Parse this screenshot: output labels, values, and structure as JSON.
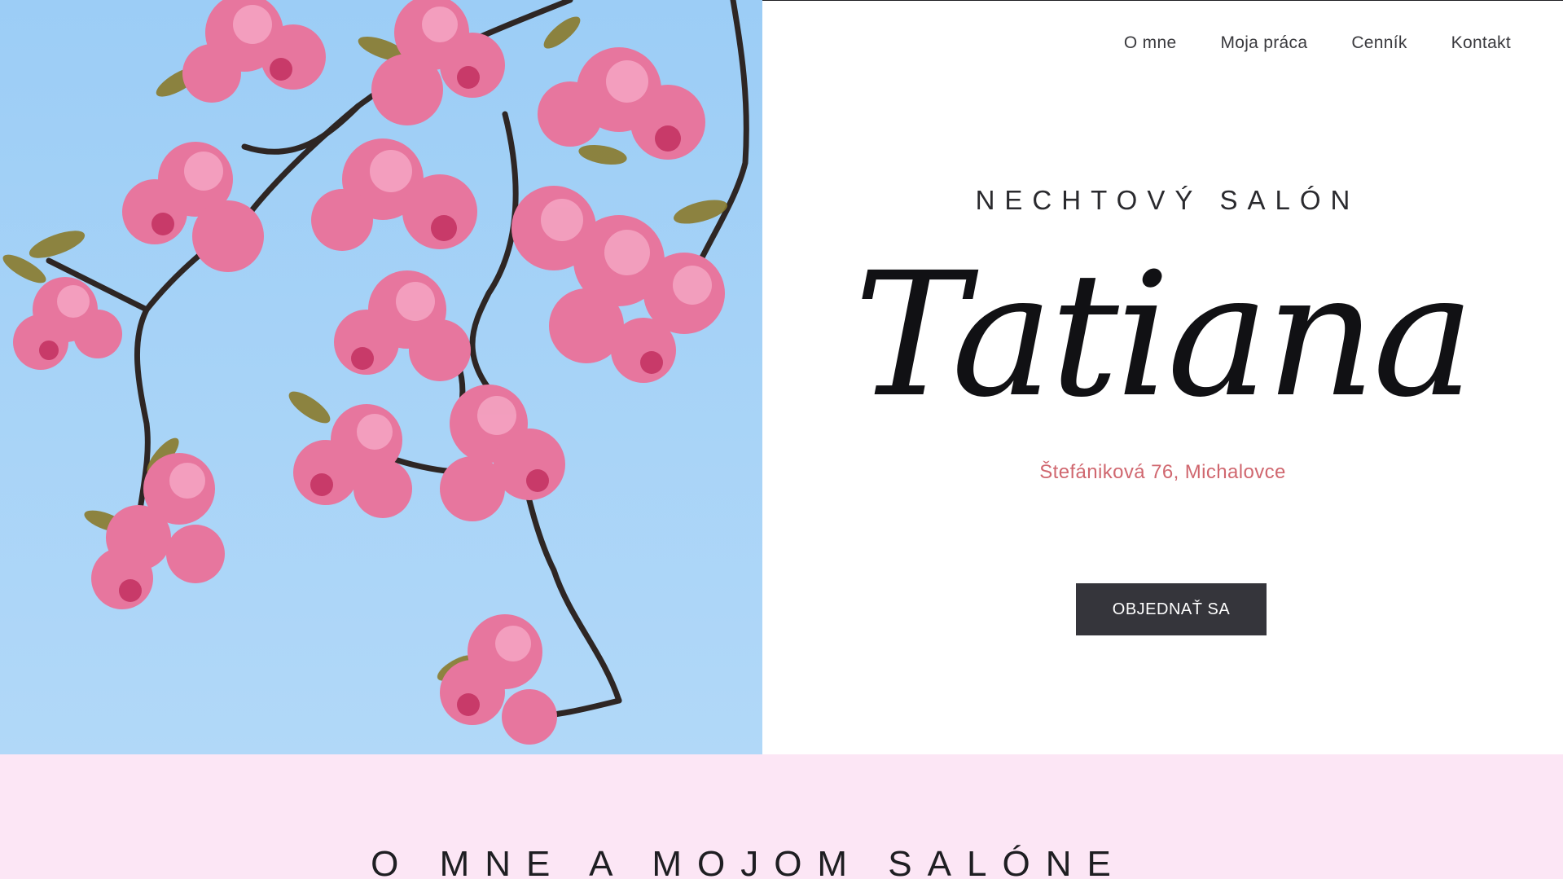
{
  "nav": {
    "items": [
      {
        "label": "O mne"
      },
      {
        "label": "Moja práca"
      },
      {
        "label": "Cenník"
      },
      {
        "label": "Kontakt"
      }
    ]
  },
  "hero": {
    "subtitle": "NECHTOVÝ SALÓN",
    "brand": "Tatiana",
    "address": "Štefániková 76, Michalovce",
    "cta_label": "OBJEDNAŤ SA",
    "image_description_icon": "cherry-blossom-branch"
  },
  "about": {
    "title": "O MNE A MOJOM SALÓNE"
  },
  "colors": {
    "accent_address": "#d0676f",
    "cta_bg": "#35353b",
    "about_bg": "#fce6f5",
    "sky": "#a7d3f7",
    "blossom": "#e46a97"
  }
}
